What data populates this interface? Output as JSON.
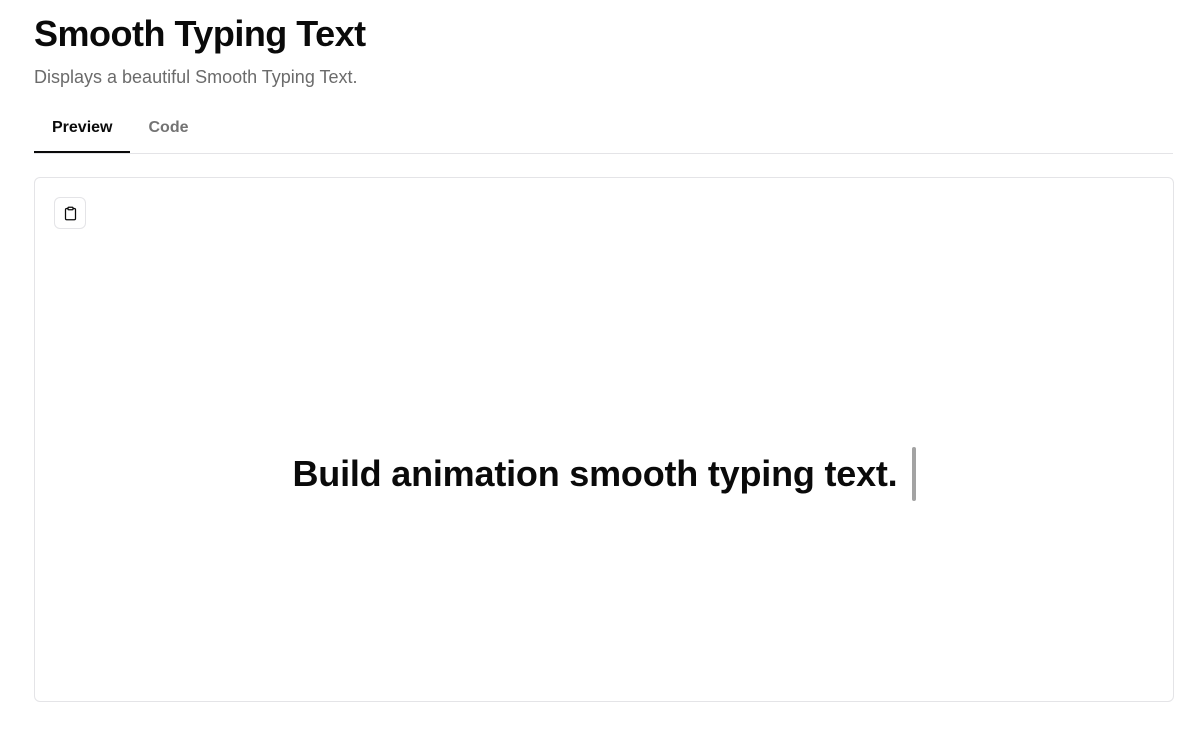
{
  "header": {
    "title": "Smooth Typing Text",
    "description": "Displays a beautiful Smooth Typing Text."
  },
  "tabs": [
    {
      "label": "Preview",
      "active": true
    },
    {
      "label": "Code",
      "active": false
    }
  ],
  "preview": {
    "copy_icon": "clipboard-icon",
    "typing_text": "Build animation smooth typing text."
  },
  "colors": {
    "text": "#0a0a0a",
    "muted": "#737373",
    "border": "#e4e4e7",
    "cursor": "#a3a3a3"
  }
}
